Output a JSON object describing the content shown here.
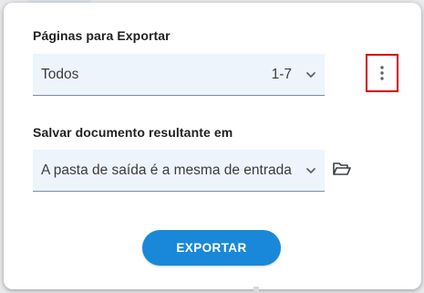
{
  "pages_section": {
    "label": "Páginas para Exportar",
    "selected_value": "Todos",
    "range": "1-7"
  },
  "save_section": {
    "label": "Salvar documento resultante em",
    "selected_value": "A pasta de saída é a mesma de entrada"
  },
  "actions": {
    "export_label": "EXPORTAR"
  },
  "icons": {
    "more": "more-vertical-icon",
    "folder": "folder-open-icon",
    "chevron": "chevron-down-icon"
  },
  "colors": {
    "accent": "#1a88d8",
    "highlight_border": "#d40000",
    "field_background": "#eef4fb"
  }
}
